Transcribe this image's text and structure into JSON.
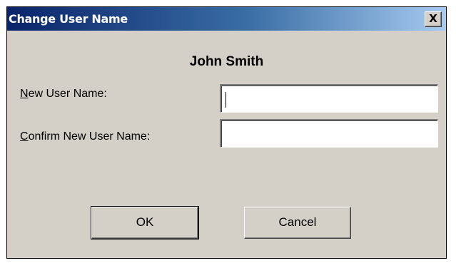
{
  "dialog": {
    "title": "Change User Name",
    "close_label": "X",
    "user_name": "John Smith"
  },
  "fields": {
    "new_name": {
      "label_accel": "N",
      "label_rest": "ew User Name:",
      "value": ""
    },
    "confirm_name": {
      "label_accel": "C",
      "label_rest": "onfirm New User Name:",
      "value": ""
    }
  },
  "buttons": {
    "ok_label": "OK",
    "cancel_label": "Cancel"
  },
  "colors": {
    "dialog_face": "#d4d0c8",
    "titlebar_start": "#0a246a",
    "titlebar_end": "#a6caf0",
    "title_text": "#ffffff"
  }
}
